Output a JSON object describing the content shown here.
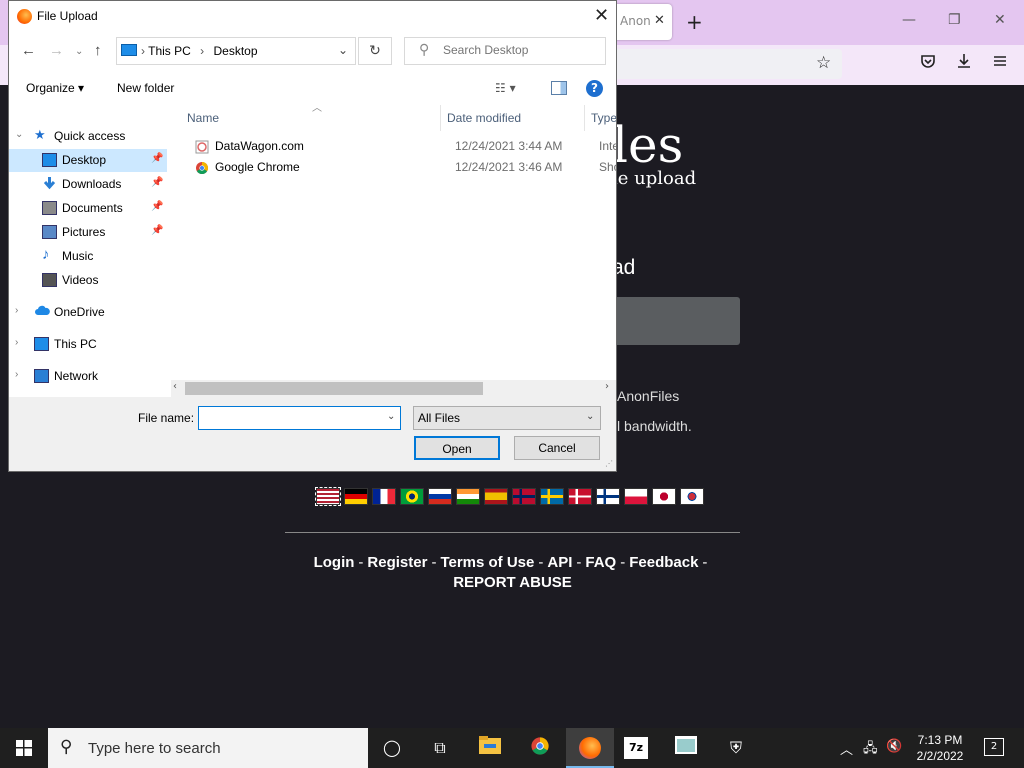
{
  "browser": {
    "tab_title": "Anon",
    "tab_close": "✕",
    "new_tab": "+",
    "controls": {
      "minimize": "—",
      "restore": "❐",
      "close": "✕"
    },
    "nav_icons": [
      "star-icon",
      "pocket-icon",
      "download-icon",
      "menu-icon"
    ]
  },
  "site": {
    "logo_partial": "les",
    "subtitle_partial": "le upload",
    "heading_partial": "ad",
    "para1_partial": "AnonFiles",
    "para2_partial": "l bandwidth.",
    "flags": [
      "us",
      "de",
      "fr",
      "br",
      "ru",
      "in",
      "es",
      "no",
      "se",
      "dk",
      "fi",
      "pl",
      "jp",
      "kr"
    ],
    "links_line1": [
      {
        "label": "Login"
      },
      {
        "label": "-"
      },
      {
        "label": "Register"
      },
      {
        "label": "-"
      },
      {
        "label": "Terms of Use"
      },
      {
        "label": "-"
      },
      {
        "label": "API"
      },
      {
        "label": "-"
      },
      {
        "label": "FAQ"
      },
      {
        "label": "-"
      },
      {
        "label": "Feedback"
      },
      {
        "label": "-"
      }
    ],
    "report_abuse": "REPORT ABUSE"
  },
  "dialog": {
    "title": "File Upload",
    "close": "✕",
    "breadcrumb": {
      "root": "This PC",
      "sep": "›",
      "folder": "Desktop"
    },
    "search_placeholder": "Search Desktop",
    "organize": "Organize ▾",
    "new_folder": "New folder",
    "help": "?",
    "nav": [
      {
        "label": "Quick access",
        "icon": "star-icon",
        "selected": false,
        "pinned": false
      },
      {
        "label": "Desktop",
        "icon": "desktop-folder-icon",
        "selected": true,
        "pinned": true
      },
      {
        "label": "Downloads",
        "icon": "downloads-folder-icon",
        "selected": false,
        "pinned": true
      },
      {
        "label": "Documents",
        "icon": "documents-folder-icon",
        "selected": false,
        "pinned": true
      },
      {
        "label": "Pictures",
        "icon": "pictures-folder-icon",
        "selected": false,
        "pinned": true
      },
      {
        "label": "Music",
        "icon": "music-folder-icon",
        "selected": false,
        "pinned": false
      },
      {
        "label": "Videos",
        "icon": "videos-folder-icon",
        "selected": false,
        "pinned": false
      },
      {
        "label": "OneDrive",
        "icon": "onedrive-icon",
        "selected": false,
        "pinned": false
      },
      {
        "label": "This PC",
        "icon": "this-pc-icon",
        "selected": false,
        "pinned": false
      },
      {
        "label": "Network",
        "icon": "network-icon",
        "selected": false,
        "pinned": false
      }
    ],
    "columns": {
      "name": "Name",
      "date": "Date modified",
      "type": "Type"
    },
    "files": [
      {
        "name": "DataWagon.com",
        "date": "12/24/2021 3:44 AM",
        "type": "Interr"
      },
      {
        "name": "Google Chrome",
        "date": "12/24/2021 3:46 AM",
        "type": "Short"
      }
    ],
    "file_name_label": "File name:",
    "file_name_value": "",
    "filter": "All Files",
    "open": "Open",
    "cancel": "Cancel"
  },
  "taskbar": {
    "search_placeholder": "Type here to search",
    "time": "7:13 PM",
    "date": "2/2/2022",
    "notifications": "2"
  }
}
